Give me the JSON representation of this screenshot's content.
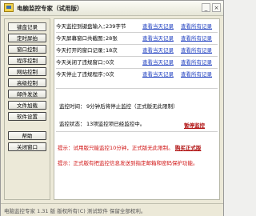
{
  "window": {
    "title": "电脑监控专家（试用版）",
    "minimize": "_",
    "close": "×"
  },
  "sidebar": {
    "items": [
      {
        "label": "键盘记录"
      },
      {
        "label": "定时屏拍"
      },
      {
        "label": "窗口控制"
      },
      {
        "label": "程序控制"
      },
      {
        "label": "网站控制"
      },
      {
        "label": "高级控制"
      },
      {
        "label": "邮件发送"
      },
      {
        "label": "文件加载"
      },
      {
        "label": "软件设置"
      },
      {
        "label": "帮助"
      },
      {
        "label": "关闭窗口"
      }
    ]
  },
  "stats": [
    {
      "label": "今天监控到键盘输入：",
      "value": "239字节",
      "link1": "查看当天记录",
      "link2": "查看所有记录"
    },
    {
      "label": "今天屏幕窗口共截图：",
      "value": "28张",
      "link1": "查看当天记录",
      "link2": "查看所有记录"
    },
    {
      "label": "今天打开的窗口记录：",
      "value": "18次",
      "link1": "查看当天记录",
      "link2": "查看所有记录"
    },
    {
      "label": "今天关闭了违规窗口：",
      "value": "0次",
      "link1": "查看当天记录",
      "link2": "查看所有记录"
    },
    {
      "label": "今天停止了违规程序：",
      "value": "0次",
      "link1": "查看当天记录",
      "link2": "查看所有记录"
    }
  ],
  "monitor": {
    "time_label": "监控时间：",
    "time_value": "9分钟后将停止监控（正式版无此限制）",
    "status_label": "监控状态：",
    "status_value": "13项监控项已经监控中。",
    "pause_link": "暂停监控"
  },
  "warnings": {
    "line1_prefix": "提示：试用版只能监控10分钟，正式版无此限制。",
    "buy_link": "购买正式版",
    "line2": "提示：正式版有把监控信息发送到指定邮箱和密码保护功能。"
  },
  "statusbar": {
    "text": "电脑监控专家  1.31 版  版权所有(C)  测试软件 保留全部权利。"
  }
}
